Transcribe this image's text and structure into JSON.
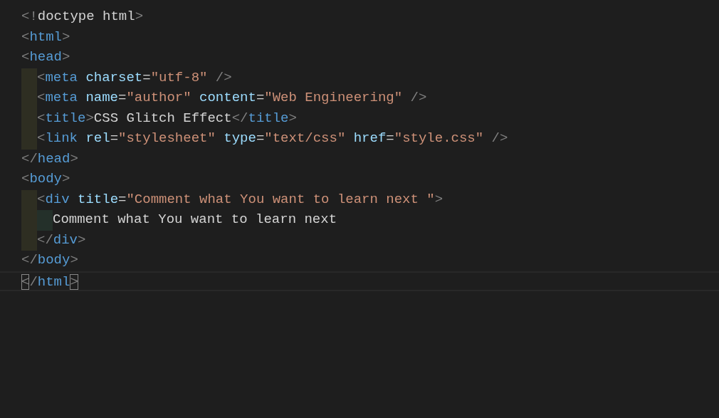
{
  "editor": {
    "lines": [
      {
        "tokens": [
          {
            "kind": "bracket",
            "text": "<!"
          },
          {
            "kind": "text",
            "text": "doctype html"
          },
          {
            "kind": "bracket",
            "text": ">"
          }
        ]
      },
      {
        "tokens": [
          {
            "kind": "bracket",
            "text": "<"
          },
          {
            "kind": "tag",
            "text": "html"
          },
          {
            "kind": "bracket",
            "text": ">"
          }
        ]
      },
      {
        "tokens": [
          {
            "kind": "bracket",
            "text": "<"
          },
          {
            "kind": "tag",
            "text": "head"
          },
          {
            "kind": "bracket",
            "text": ">"
          }
        ],
        "children": [
          {
            "tokens": [
              {
                "kind": "bracket",
                "text": "<"
              },
              {
                "kind": "tag",
                "text": "meta"
              },
              {
                "kind": "attr",
                "text": " charset"
              },
              {
                "kind": "text",
                "text": "="
              },
              {
                "kind": "string",
                "text": "\"utf-8\""
              },
              {
                "kind": "bracket",
                "text": " />"
              }
            ]
          },
          {
            "tokens": [
              {
                "kind": "bracket",
                "text": "<"
              },
              {
                "kind": "tag",
                "text": "meta"
              },
              {
                "kind": "attr",
                "text": " name"
              },
              {
                "kind": "text",
                "text": "="
              },
              {
                "kind": "string",
                "text": "\"author\""
              },
              {
                "kind": "attr",
                "text": " content"
              },
              {
                "kind": "text",
                "text": "="
              },
              {
                "kind": "string",
                "text": "\"Web Engineering\""
              },
              {
                "kind": "bracket",
                "text": " />"
              }
            ]
          },
          {
            "tokens": [
              {
                "kind": "bracket",
                "text": "<"
              },
              {
                "kind": "tag",
                "text": "title"
              },
              {
                "kind": "bracket",
                "text": ">"
              },
              {
                "kind": "text",
                "text": "CSS Glitch Effect"
              },
              {
                "kind": "bracket",
                "text": "</"
              },
              {
                "kind": "tag",
                "text": "title"
              },
              {
                "kind": "bracket",
                "text": ">"
              }
            ]
          },
          {
            "tokens": [
              {
                "kind": "bracket",
                "text": "<"
              },
              {
                "kind": "tag",
                "text": "link"
              },
              {
                "kind": "attr",
                "text": " rel"
              },
              {
                "kind": "text",
                "text": "="
              },
              {
                "kind": "string",
                "text": "\"stylesheet\""
              },
              {
                "kind": "attr",
                "text": " type"
              },
              {
                "kind": "text",
                "text": "="
              },
              {
                "kind": "string",
                "text": "\"text/css\""
              },
              {
                "kind": "attr",
                "text": " href"
              },
              {
                "kind": "text",
                "text": "="
              },
              {
                "kind": "string",
                "text": "\"style.css\""
              },
              {
                "kind": "bracket",
                "text": " />"
              }
            ]
          }
        ]
      },
      {
        "tokens": [
          {
            "kind": "bracket",
            "text": "</"
          },
          {
            "kind": "tag",
            "text": "head"
          },
          {
            "kind": "bracket",
            "text": ">"
          }
        ]
      },
      {
        "tokens": [
          {
            "kind": "bracket",
            "text": "<"
          },
          {
            "kind": "tag",
            "text": "body"
          },
          {
            "kind": "bracket",
            "text": ">"
          }
        ],
        "children": [
          {
            "tokens": [
              {
                "kind": "bracket",
                "text": "<"
              },
              {
                "kind": "tag",
                "text": "div"
              },
              {
                "kind": "attr",
                "text": " title"
              },
              {
                "kind": "text",
                "text": "="
              },
              {
                "kind": "string",
                "text": "\"Comment what You want to learn next \""
              },
              {
                "kind": "bracket",
                "text": ">"
              }
            ],
            "children": [
              {
                "tokens": [
                  {
                    "kind": "text",
                    "text": "Comment what You want to learn next"
                  }
                ]
              }
            ]
          },
          {
            "tokens": [
              {
                "kind": "bracket",
                "text": "</"
              },
              {
                "kind": "tag",
                "text": "div"
              },
              {
                "kind": "bracket",
                "text": ">"
              }
            ]
          }
        ]
      },
      {
        "tokens": [
          {
            "kind": "bracket",
            "text": "</"
          },
          {
            "kind": "tag",
            "text": "body"
          },
          {
            "kind": "bracket",
            "text": ">"
          }
        ]
      },
      {
        "current": true,
        "tokens": [
          {
            "kind": "bracket",
            "text": "<",
            "matched": true
          },
          {
            "kind": "bracket",
            "text": "/"
          },
          {
            "kind": "tag",
            "text": "html"
          },
          {
            "kind": "bracket",
            "text": ">",
            "matched": true
          }
        ]
      }
    ]
  }
}
